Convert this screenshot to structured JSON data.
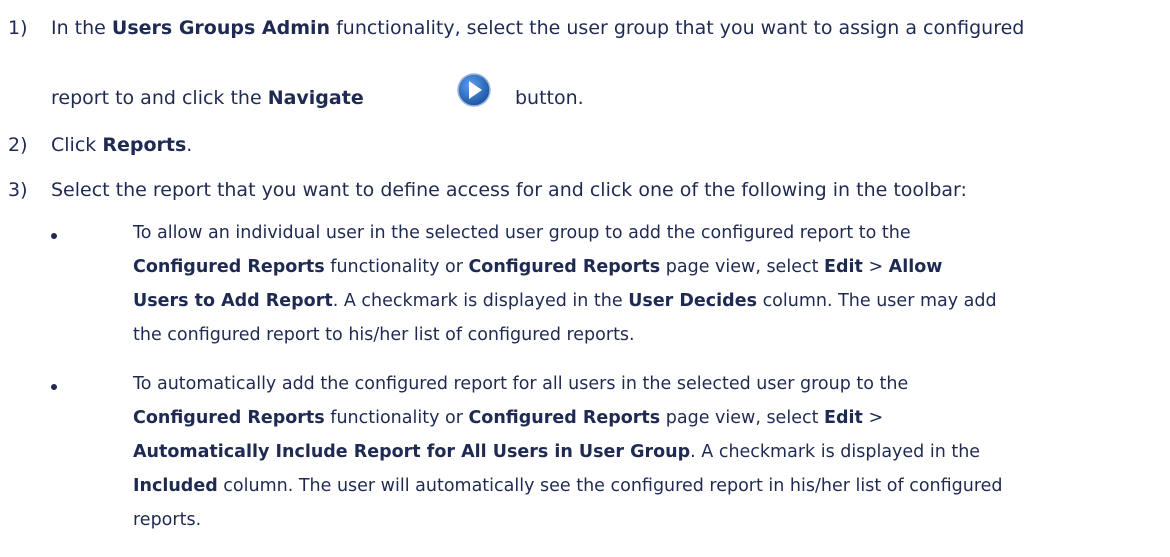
{
  "steps": [
    {
      "number": "1)",
      "line1": [
        "In the ",
        "Users Groups Admin",
        " functionality, select the user group that you want to assign a configured"
      ],
      "line2": [
        "report to and click the ",
        "Navigate",
        " button."
      ],
      "icon": "navigate-arrow-icon"
    },
    {
      "number": "2)",
      "parts": [
        "Click ",
        "Reports",
        "."
      ]
    },
    {
      "number": "3)",
      "text": "Select the report that you want to define access for and click one of the following in the toolbar:"
    }
  ],
  "bullets": [
    {
      "lines": [
        [
          "To allow an individual user in the selected user group to add the configured report to the"
        ],
        [
          "",
          "Configured Reports",
          " functionality or ",
          "Configured Reports",
          " page view, select ",
          "Edit",
          " > ",
          "Allow"
        ],
        [
          "",
          "Users to Add Report",
          ". A checkmark is displayed in the ",
          "User Decides",
          " column. The user may add"
        ],
        [
          "the configured report to his/her list of configured reports."
        ]
      ]
    },
    {
      "lines": [
        [
          "To automatically add the configured report for all users in the selected user group to the"
        ],
        [
          "",
          "Configured Reports",
          " functionality or ",
          "Configured Reports",
          " page view, select ",
          "Edit",
          " >"
        ],
        [
          "",
          "Automatically Include Report for All Users in User Group",
          ". A checkmark is displayed in the"
        ],
        [
          "",
          "Included",
          " column. The user will automatically see the configured report in his/her list of configured"
        ],
        [
          "reports."
        ]
      ]
    }
  ],
  "colors": {
    "text": "#1f2a52",
    "icon_blue": "#1f5fb0"
  }
}
